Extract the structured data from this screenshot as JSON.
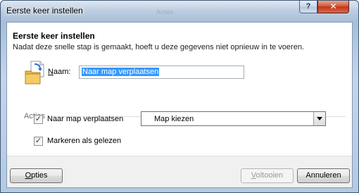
{
  "window": {
    "title": "Eerste keer instellen",
    "background_title": "Acties",
    "help_glyph": "?",
    "close_glyph": "✕"
  },
  "header": {
    "title": "Eerste keer instellen",
    "description": "Nadat deze snelle stap is gemaakt, hoeft u deze gegevens niet opnieuw in te voeren."
  },
  "name_field": {
    "label_accel": "N",
    "label_rest": "aam:",
    "value": "Naar map verplaatsen"
  },
  "actions": {
    "section_label": "Acties",
    "move_to_folder": {
      "checked": true,
      "label": "Naar map verplaatsen",
      "select_value": "Map kiezen"
    },
    "mark_as_read": {
      "checked": true,
      "label": "Markeren als gelezen"
    }
  },
  "footer": {
    "options_accel": "O",
    "options_rest": "pties",
    "finish_accel": "V",
    "finish_rest": "oltooien",
    "finish_enabled": false,
    "cancel_label": "Annuleren"
  },
  "icons": {
    "document": "document-folder-icon",
    "check": "✓"
  },
  "colors": {
    "selection": "#3399ff",
    "close_button": "#c2361a"
  }
}
